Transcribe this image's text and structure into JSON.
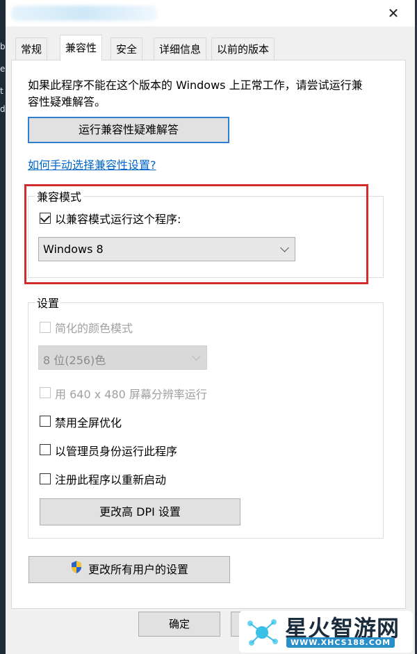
{
  "window": {
    "close_glyph": "✕",
    "left_fragments": [
      "b",
      "e",
      "t",
      "d"
    ]
  },
  "tabs": [
    {
      "label": "常规",
      "active": false
    },
    {
      "label": "兼容性",
      "active": true
    },
    {
      "label": "安全",
      "active": false
    },
    {
      "label": "详细信息",
      "active": false
    },
    {
      "label": "以前的版本",
      "active": false
    }
  ],
  "intro": {
    "line1": "如果此程序不能在这个版本的 Windows 上正常工作，请尝试运行兼",
    "line2": "容性疑难解答。"
  },
  "troubleshooter_button": "运行兼容性疑难解答",
  "manual_link": "如何手动选择兼容性设置?",
  "compat_mode": {
    "group_label": "兼容模式",
    "checkbox_label": "以兼容模式运行这个程序:",
    "checked": true,
    "selected_os": "Windows 8"
  },
  "settings": {
    "group_label": "设置",
    "reduced_color_label": "简化的颜色模式",
    "color_depth_value": "8 位(256)色",
    "res_640_label": "用 640 x 480 屏幕分辨率运行",
    "fullscreen_label": "禁用全屏优化",
    "admin_label": "以管理员身份运行此程序",
    "restart_label": "注册此程序以重新启动",
    "dpi_button": "更改高 DPI 设置"
  },
  "all_users_button": "更改所有用户的设置",
  "ok_button": "确定",
  "watermark": {
    "title": "星火智游网",
    "url": "WWW.XHCS188.COM"
  },
  "colors": {
    "highlight": "#d22b2b",
    "link": "#0066cc",
    "button_focus": "#2f7fd0"
  }
}
